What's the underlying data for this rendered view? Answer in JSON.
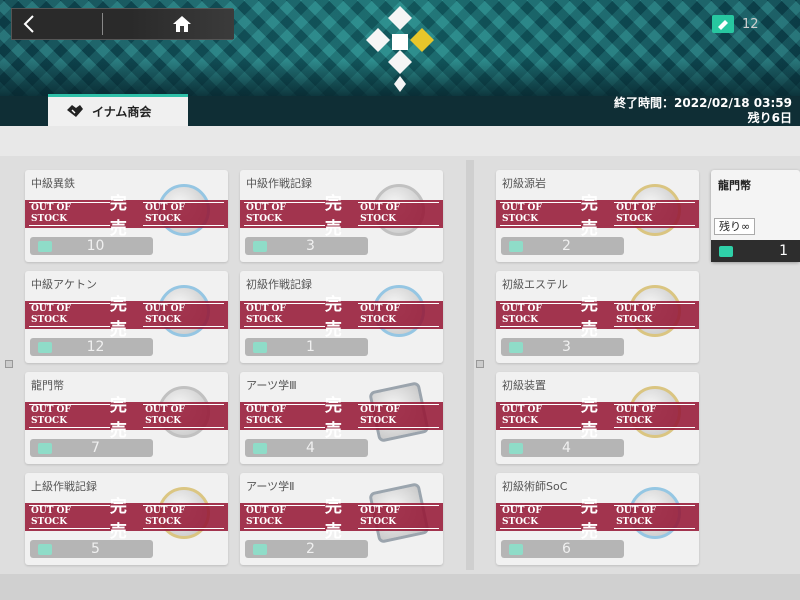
{
  "header": {
    "currency_value": "12",
    "icons": {
      "back": "back-arrow-icon",
      "home": "home-icon",
      "currency": "currency-ticket-icon",
      "emblem": "shop-emblem-icon"
    },
    "colors": {
      "accent": "#2fc0a8",
      "sold_out": "#961937"
    }
  },
  "shop": {
    "tab_label": "イナム商会",
    "end_time": "終了時間：2022/02/18 03:59",
    "remaining": "残り6日"
  },
  "sold_out": {
    "label_en": "OUT OF STOCK",
    "label_jp": "完売"
  },
  "items": [
    {
      "name": "中級異鉄",
      "price": "10"
    },
    {
      "name": "中級作戦記録",
      "price": "3"
    },
    {
      "name": "中級アケトン",
      "price": "12"
    },
    {
      "name": "初級作戦記録",
      "price": "1"
    },
    {
      "name": "龍門幣",
      "price": "7"
    },
    {
      "name": "アーツ学Ⅲ",
      "price": "4"
    },
    {
      "name": "上級作戦記録",
      "price": "5"
    },
    {
      "name": "アーツ学Ⅱ",
      "price": "2"
    },
    {
      "name": "初級源岩",
      "price": "2"
    },
    {
      "name": "初級エステル",
      "price": "3"
    },
    {
      "name": "初級装置",
      "price": "4"
    },
    {
      "name": "初級術師SoC",
      "price": "6"
    }
  ],
  "special_item": {
    "name": "龍門幣",
    "remaining": "残り∞",
    "price": "1"
  }
}
